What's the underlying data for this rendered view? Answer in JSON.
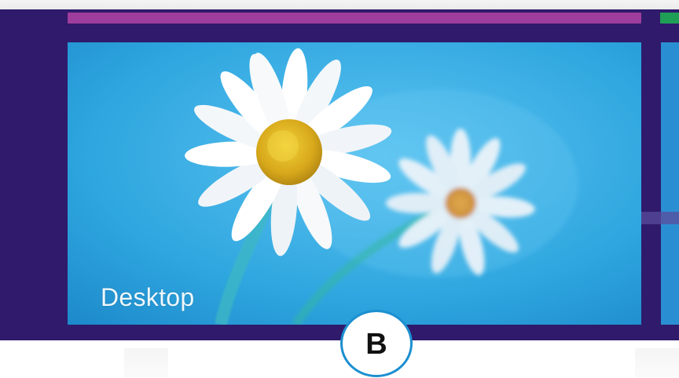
{
  "start_screen": {
    "background_color": "#2f1a6b",
    "tiles": [
      {
        "name": "Desktop",
        "label": "Desktop",
        "wallpaper": "daisies-on-blue-sky",
        "color": "#2fa6df"
      }
    ],
    "top_tile_color": "#9e3d9b",
    "side_tile_color": "#1f9e56"
  },
  "callout": {
    "label": "B",
    "border_color": "#1c8fd0"
  }
}
